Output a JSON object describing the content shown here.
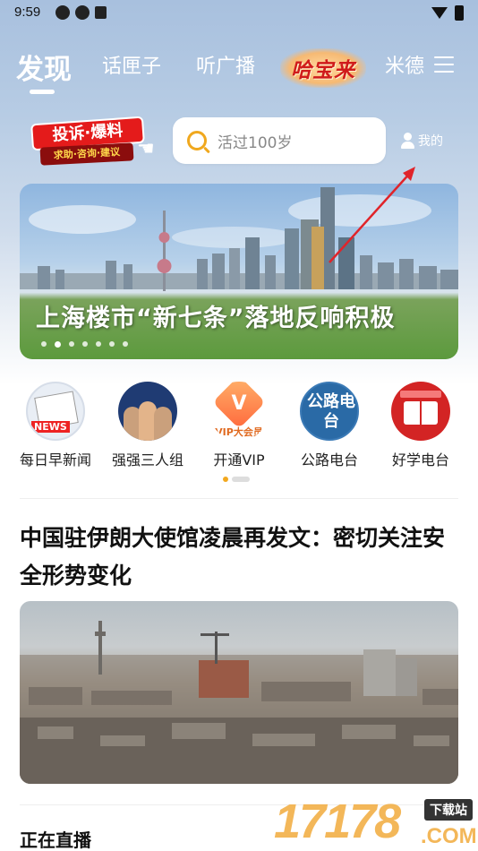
{
  "status_bar": {
    "time": "9:59"
  },
  "top_nav": {
    "tabs": [
      {
        "label": "发现",
        "active": true
      },
      {
        "label": "话匣子",
        "active": false
      },
      {
        "label": "听广播",
        "active": false
      },
      {
        "label": "米德",
        "active": false
      }
    ],
    "logo_text": "哈宝来"
  },
  "complaint_badge": {
    "title": "投诉·爆料",
    "subtitle": "求助·咨询·建议"
  },
  "search": {
    "placeholder": "活过100岁"
  },
  "mine": {
    "label": "我的"
  },
  "banner": {
    "caption": "上海楼市“新七条”落地反响积极",
    "slide_count": 7,
    "active_slide": 2
  },
  "shortcuts": [
    {
      "label": "每日早新闻",
      "icon": "newspaper-icon",
      "badge": "NEWS"
    },
    {
      "label": "强强三人组",
      "icon": "three-hosts-icon"
    },
    {
      "label": "开通VIP",
      "icon": "vip-icon",
      "badge": "VIP大会员"
    },
    {
      "label": "公路电台",
      "icon": "road-radio-icon",
      "badge": "公路电台"
    },
    {
      "label": "好学电台",
      "icon": "study-radio-icon"
    }
  ],
  "shortcut_pager": {
    "pages": 2,
    "active": 1
  },
  "headline": {
    "title": "中国驻伊朗大使馆凌晨再发文：密切关注安全形势变化"
  },
  "section": {
    "live_title": "正在直播"
  },
  "watermark": {
    "digits": "17178",
    "tag": "下载站",
    "suffix": ".COM"
  },
  "colors": {
    "accent": "#f0a81e",
    "brand_red": "#e41b1b",
    "annotation_arrow": "#e0242a"
  }
}
